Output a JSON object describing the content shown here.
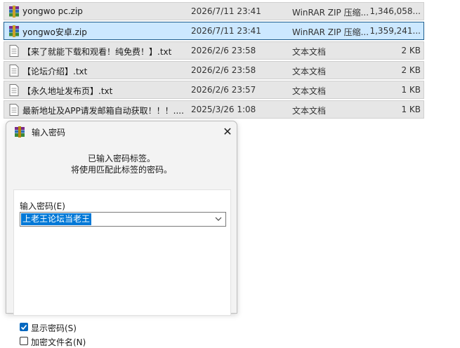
{
  "files": [
    {
      "icon": "winrar-archive-icon",
      "name": "yongwo pc.zip",
      "date": "2026/7/11 23:41",
      "type": "WinRAR ZIP 压缩...",
      "size": "1,346,058...",
      "selected": false
    },
    {
      "icon": "winrar-archive-icon",
      "name": "yongwo安卓.zip",
      "date": "2026/7/11 23:41",
      "type": "WinRAR ZIP 压缩...",
      "size": "1,359,241...",
      "selected": true
    },
    {
      "icon": "text-document-icon",
      "name": "【来了就能下载和观看！纯免费！】.txt",
      "date": "2026/2/6 23:58",
      "type": "文本文档",
      "size": "2 KB",
      "selected": false
    },
    {
      "icon": "text-document-icon",
      "name": "【论坛介绍】.txt",
      "date": "2026/2/6 23:58",
      "type": "文本文档",
      "size": "2 KB",
      "selected": false
    },
    {
      "icon": "text-document-icon",
      "name": "【永久地址发布页】.txt",
      "date": "2026/2/6 23:57",
      "type": "文本文档",
      "size": "1 KB",
      "selected": false
    },
    {
      "icon": "text-document-icon",
      "name": "最新地址及APP请发邮箱自动获取！！！....",
      "date": "2025/3/26 1:08",
      "type": "文本文档",
      "size": "1 KB",
      "selected": false
    }
  ],
  "dialog": {
    "title": "输入密码",
    "message_line1": "已输入密码标签。",
    "message_line2": "将使用匹配此标签的密码。",
    "password_label": "输入密码(E)",
    "password_value": "上老王论坛当老王",
    "show_password_label": "显示密码(S)",
    "show_password_checked": true,
    "encrypt_names_label": "加密文件名(N)",
    "encrypt_names_checked": false
  },
  "colors": {
    "selection": "#cce8ff",
    "row": "#e6e6e6",
    "accent": "#0078d7"
  }
}
